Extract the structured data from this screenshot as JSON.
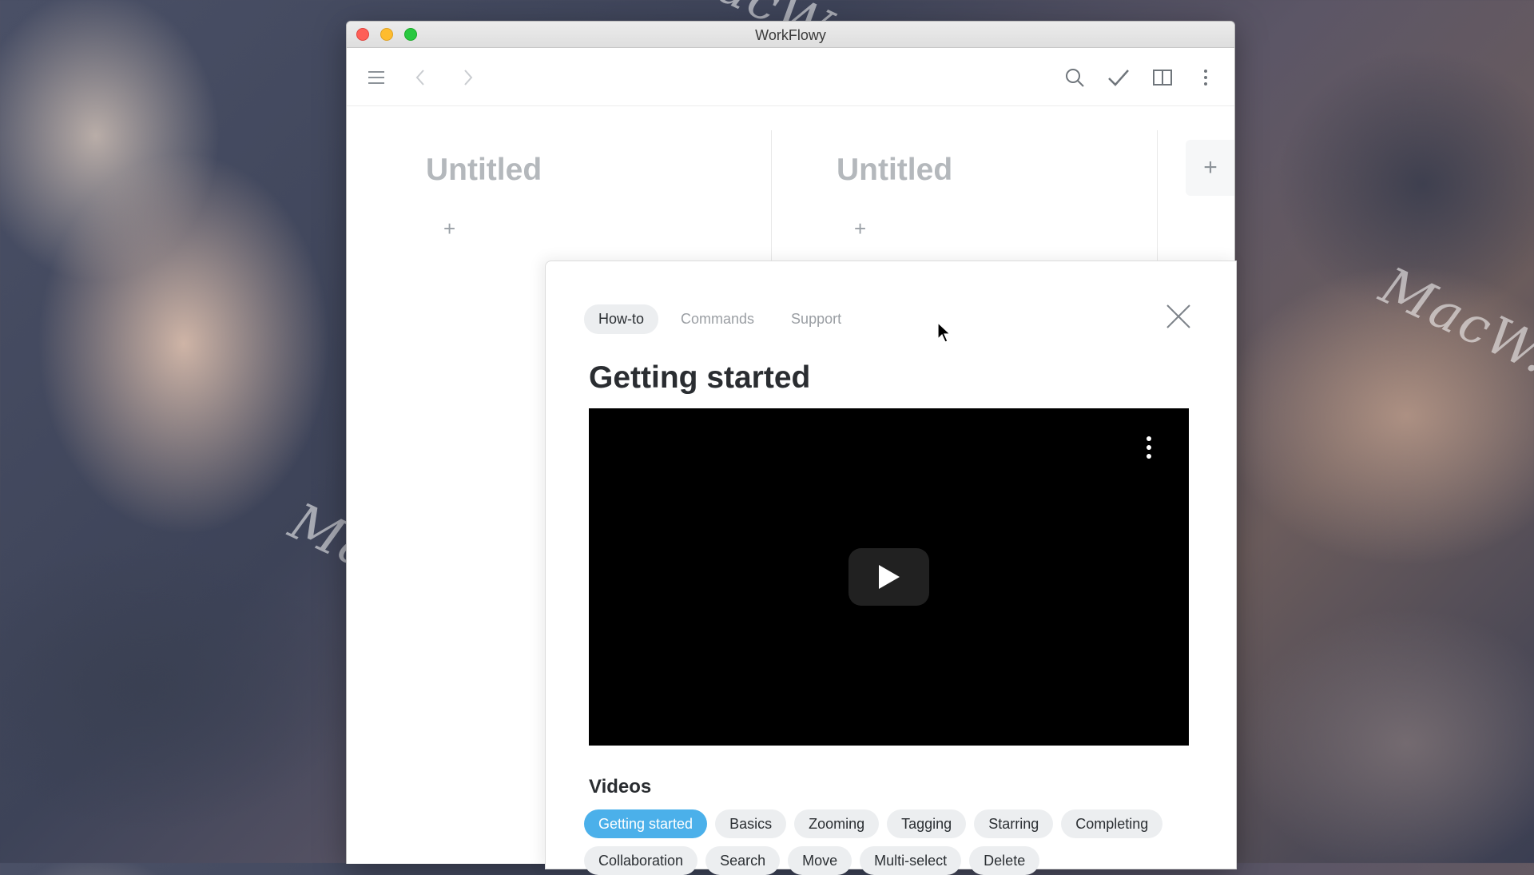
{
  "window": {
    "title": "WorkFlowy"
  },
  "toolbar": {
    "menu_icon": "hamburger-menu-icon",
    "back_icon": "chevron-left-icon",
    "forward_icon": "chevron-right-icon",
    "search_icon": "search-icon",
    "complete_icon": "checkmark-icon",
    "layout_icon": "split-view-icon",
    "more_icon": "vertical-dots-icon"
  },
  "columns": [
    {
      "title": "Untitled",
      "add_label": "+"
    },
    {
      "title": "Untitled",
      "add_label": "+"
    }
  ],
  "add_column_label": "+",
  "watermark": "MacW.com",
  "help_panel": {
    "tabs": [
      {
        "label": "How-to",
        "active": true
      },
      {
        "label": "Commands",
        "active": false
      },
      {
        "label": "Support",
        "active": false
      }
    ],
    "title": "Getting started",
    "section_title": "Videos",
    "chips": [
      {
        "label": "Getting started",
        "active": true
      },
      {
        "label": "Basics",
        "active": false
      },
      {
        "label": "Zooming",
        "active": false
      },
      {
        "label": "Tagging",
        "active": false
      },
      {
        "label": "Starring",
        "active": false
      },
      {
        "label": "Completing",
        "active": false
      },
      {
        "label": "Collaboration",
        "active": false
      },
      {
        "label": "Search",
        "active": false
      },
      {
        "label": "Move",
        "active": false
      },
      {
        "label": "Multi-select",
        "active": false
      },
      {
        "label": "Delete",
        "active": false
      }
    ]
  },
  "colors": {
    "accent": "#4bb0ea",
    "title_text": "#2a2d31",
    "muted_title": "#b4b8bc"
  }
}
